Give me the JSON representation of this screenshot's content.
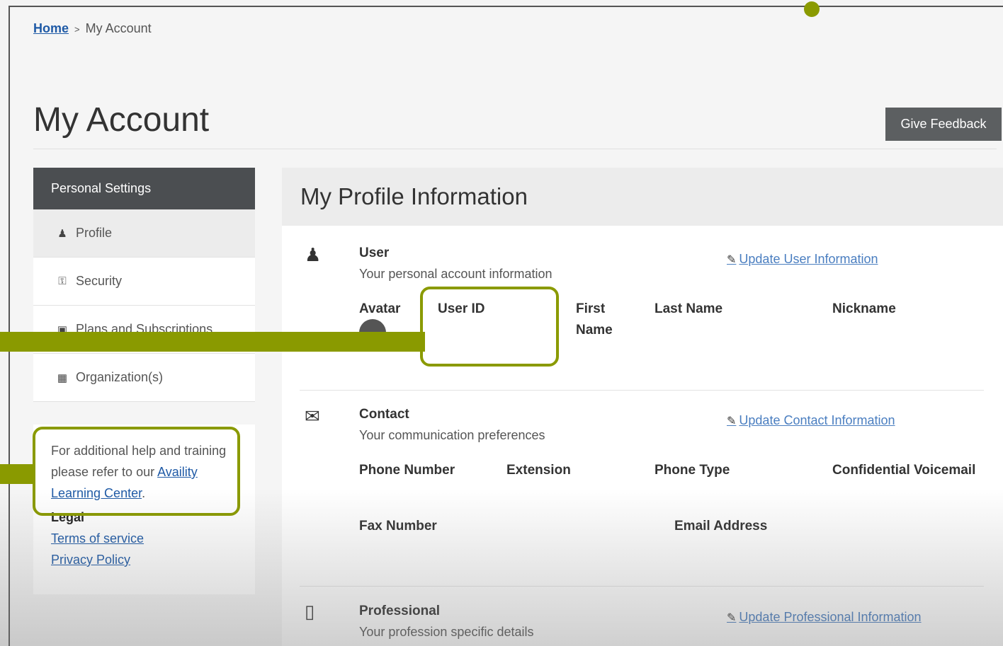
{
  "breadcrumb": {
    "home": "Home",
    "separator": ">",
    "current": "My Account"
  },
  "page_title": "My Account",
  "feedback_button": "Give Feedback",
  "sidebar": {
    "header": "Personal Settings",
    "items": [
      {
        "label": "Profile",
        "icon": "user-icon",
        "active": true
      },
      {
        "label": "Security",
        "icon": "key-icon",
        "active": false
      },
      {
        "label": "Plans and Subscriptions",
        "icon": "card-icon",
        "active": false
      },
      {
        "label": "Organization(s)",
        "icon": "building-icon",
        "active": false
      }
    ],
    "help_text": "For additional help and training please refer to our",
    "help_link": "Availity Learning Center",
    "help_end": ".",
    "legal_title": "Legal",
    "terms_link": "Terms of service",
    "privacy_link": "Privacy Policy"
  },
  "profile": {
    "title": "My Profile Information",
    "user": {
      "title": "User",
      "subtitle": "Your personal account information",
      "update_link": "Update User Information",
      "fields": [
        "Avatar",
        "User ID",
        "First Name",
        "Last Name",
        "Nickname"
      ]
    },
    "contact": {
      "title": "Contact",
      "subtitle": "Your communication preferences",
      "update_link": "Update Contact Information",
      "fields": [
        "Phone Number",
        "Extension",
        "Phone Type",
        "Confidential Voicemail",
        "Fax Number",
        "Email Address"
      ]
    },
    "professional": {
      "title": "Professional",
      "subtitle": "Your profession specific details",
      "update_link": "Update Professional Information"
    }
  },
  "colors": {
    "accent_callout": "#8a9a00",
    "link": "#1f5aa6",
    "sidebar_header": "#4b4e51"
  }
}
